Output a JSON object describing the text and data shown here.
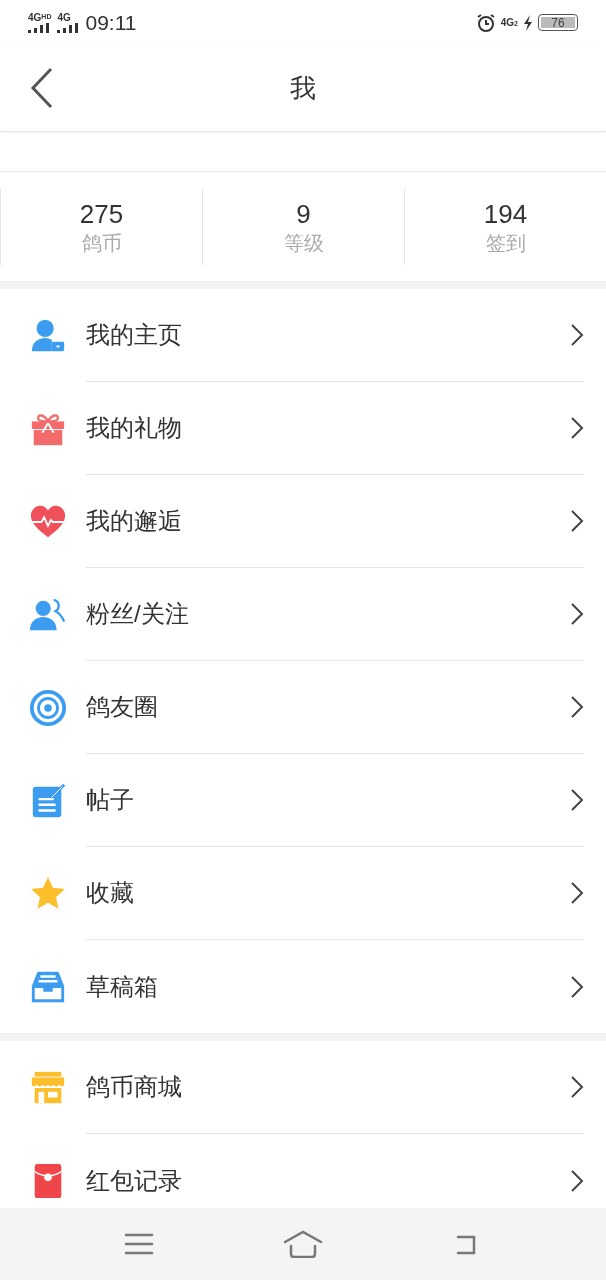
{
  "status_bar": {
    "sim_1": "4G",
    "sim_1_badge": "HD",
    "sim_2": "4G",
    "time": "09:11",
    "data": "4G",
    "data_sub": "2",
    "battery": "76"
  },
  "header": {
    "title": "我"
  },
  "stats": [
    {
      "value": "275",
      "label": "鸽币"
    },
    {
      "value": "9",
      "label": "等级"
    },
    {
      "value": "194",
      "label": "签到"
    }
  ],
  "menu_groups": [
    [
      {
        "label": "我的主页"
      },
      {
        "label": "我的礼物"
      },
      {
        "label": "我的邂逅"
      },
      {
        "label": "粉丝/关注"
      },
      {
        "label": "鸽友圈"
      },
      {
        "label": "帖子"
      },
      {
        "label": "收藏"
      },
      {
        "label": "草稿箱"
      }
    ],
    [
      {
        "label": "鸽币商城"
      },
      {
        "label": "红包记录"
      }
    ]
  ]
}
